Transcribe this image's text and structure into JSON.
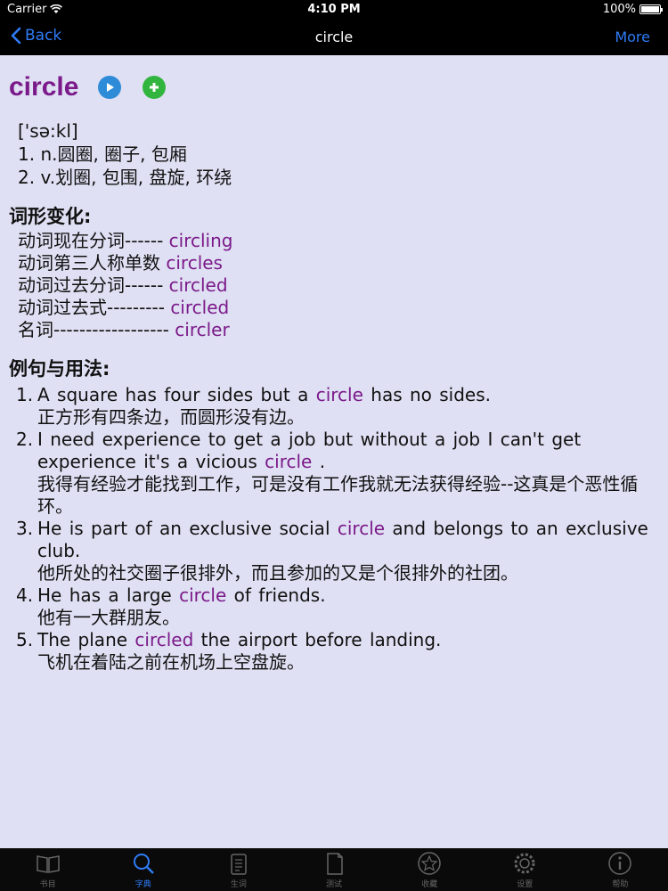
{
  "status": {
    "carrier": "Carrier",
    "time": "4:10 PM",
    "battery": "100%"
  },
  "nav": {
    "back_label": "Back",
    "title": "circle",
    "more_label": "More"
  },
  "entry": {
    "word": "circle",
    "phonetic": "['sə:kl]",
    "definitions": [
      "1. n.圆圈, 圈子, 包厢",
      "2. v.划圈, 包围, 盘旋, 环绕"
    ]
  },
  "forms": {
    "title": "词形变化:",
    "items": [
      {
        "label": "动词现在分词------",
        "value": "circling"
      },
      {
        "label": "动词第三人称单数",
        "value": "circles"
      },
      {
        "label": "动词过去分词------",
        "value": "circled"
      },
      {
        "label": "动词过去式---------",
        "value": "circled"
      },
      {
        "label": "名词------------------",
        "value": "circler"
      }
    ]
  },
  "examples": {
    "title": "例句与用法:",
    "items": [
      {
        "num": "1.",
        "pre": "A square has four sides but a ",
        "hl": "circle",
        "post": " has no sides.",
        "zh": "正方形有四条边，而圆形没有边。"
      },
      {
        "num": "2.",
        "pre": "I need experience to get a job but without a job I can't get experience it's a vicious ",
        "hl": "circle",
        "post": " .",
        "zh": "我得有经验才能找到工作，可是没有工作我就无法获得经验--这真是个恶性循环。"
      },
      {
        "num": "3.",
        "pre": "He is part of an exclusive social ",
        "hl": "circle",
        "post": " and belongs to an exclusive club.",
        "zh": "他所处的社交圈子很排外，而且参加的又是个很排外的社团。"
      },
      {
        "num": "4.",
        "pre": "He has a large ",
        "hl": "circle",
        "post": " of friends.",
        "zh": "他有一大群朋友。"
      },
      {
        "num": "5.",
        "pre": "The plane ",
        "hl": "circled",
        "post": " the airport before landing.",
        "zh": "飞机在着陆之前在机场上空盘旋。"
      }
    ]
  },
  "tabs": [
    {
      "label": "书目",
      "icon": "book-icon",
      "active": false
    },
    {
      "label": "字典",
      "icon": "search-icon",
      "active": true
    },
    {
      "label": "生词",
      "icon": "clipboard-icon",
      "active": false
    },
    {
      "label": "测试",
      "icon": "test-icon",
      "active": false
    },
    {
      "label": "收藏",
      "icon": "star-icon",
      "active": false
    },
    {
      "label": "设置",
      "icon": "gear-icon",
      "active": false
    },
    {
      "label": "帮助",
      "icon": "info-icon",
      "active": false
    }
  ],
  "colors": {
    "accent": "#2f7cf6",
    "highlight": "#7b1a8a",
    "background": "#dfe0f3"
  }
}
